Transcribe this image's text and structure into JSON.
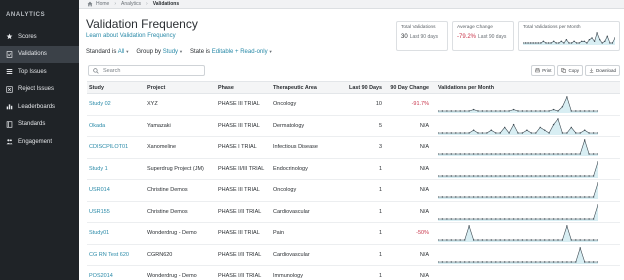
{
  "sidebar": {
    "title": "ANALYTICS",
    "items": [
      {
        "label": "Scores",
        "icon": "star-icon"
      },
      {
        "label": "Validations",
        "icon": "check-doc-icon",
        "active": true
      },
      {
        "label": "Top Issues",
        "icon": "list-icon"
      },
      {
        "label": "Reject Issues",
        "icon": "reject-icon"
      },
      {
        "label": "Leaderboards",
        "icon": "chart-icon"
      },
      {
        "label": "Standards",
        "icon": "book-icon"
      },
      {
        "label": "Engagement",
        "icon": "people-icon"
      }
    ]
  },
  "breadcrumb": [
    "Home",
    "Analytics",
    "Validations"
  ],
  "header": {
    "title": "Validation Frequency",
    "learn_link": "Learn about Validation Frequency"
  },
  "filters": {
    "standard_label": "Standard is",
    "standard_value": "All",
    "group_label": "Group by",
    "group_value": "Study",
    "state_label": "State is",
    "state_value": "Editable + Read-only"
  },
  "stats": {
    "total_label": "Total Validations",
    "total_value": "30",
    "total_sub": "Last 90 days",
    "avg_label": "Average Change",
    "avg_value": "-79.2%",
    "avg_sub": "Last 90 days",
    "month_label": "Total Validations per Month"
  },
  "search": {
    "placeholder": "Search"
  },
  "toolbar": {
    "print": "Print",
    "copy": "Copy",
    "download": "Download"
  },
  "table": {
    "headers": [
      "Study",
      "Project",
      "Phase",
      "Therapeutic Area",
      "Last 90 Days",
      "90 Day Change",
      "Validations per Month"
    ],
    "rows": [
      {
        "study": "Study 02",
        "project": "XYZ",
        "phase": "PHASE III TRIAL",
        "area": "Oncology",
        "last90": "10",
        "change": "-91.7%",
        "neg": true,
        "spark": [
          0,
          0,
          0,
          0,
          0,
          0,
          0,
          0,
          1,
          0,
          0,
          0,
          0,
          0,
          0,
          0,
          0,
          1,
          0,
          0,
          0,
          0,
          0,
          0,
          0,
          0,
          1,
          0,
          3,
          10,
          0,
          0,
          0,
          0,
          0,
          0,
          0
        ]
      },
      {
        "study": "Okada",
        "project": "Yamazaki",
        "phase": "PHASE III TRIAL",
        "area": "Dermatology",
        "last90": "5",
        "change": "N/A",
        "neg": false,
        "spark": [
          0,
          0,
          0,
          0,
          0,
          0,
          0,
          0,
          1,
          0,
          0,
          0,
          1,
          0,
          0,
          2,
          0,
          3,
          0,
          0,
          1,
          0,
          0,
          2,
          1,
          0,
          3,
          5,
          0,
          0,
          2,
          0,
          0,
          1,
          0,
          0,
          0
        ]
      },
      {
        "study": "CDISCPILOT01",
        "project": "Xanomeline",
        "phase": "PHASE I TRIAL",
        "area": "Infectious Disease",
        "last90": "3",
        "change": "N/A",
        "neg": false,
        "spark": [
          0,
          0,
          0,
          0,
          0,
          0,
          0,
          0,
          0,
          0,
          0,
          0,
          0,
          0,
          0,
          0,
          0,
          0,
          0,
          0,
          0,
          0,
          0,
          0,
          0,
          0,
          0,
          0,
          0,
          0,
          0,
          0,
          0,
          4,
          0,
          0,
          0
        ]
      },
      {
        "study": "Study 1",
        "project": "Superdrug Project (JM)",
        "phase": "PHASE II/III TRIAL",
        "area": "Endocrinology",
        "last90": "1",
        "change": "N/A",
        "neg": false,
        "spark": [
          0,
          0,
          0,
          0,
          0,
          0,
          0,
          0,
          0,
          0,
          0,
          0,
          0,
          0,
          0,
          0,
          0,
          0,
          0,
          0,
          0,
          0,
          0,
          0,
          0,
          0,
          0,
          0,
          0,
          0,
          0,
          0,
          0,
          0,
          0,
          0,
          3
        ]
      },
      {
        "study": "USR014",
        "project": "Christine Demos",
        "phase": "PHASE III TRIAL",
        "area": "Oncology",
        "last90": "1",
        "change": "N/A",
        "neg": false,
        "spark": [
          0,
          0,
          0,
          0,
          0,
          0,
          0,
          0,
          0,
          0,
          0,
          0,
          0,
          0,
          0,
          0,
          0,
          0,
          0,
          0,
          0,
          0,
          0,
          0,
          0,
          0,
          0,
          0,
          0,
          0,
          0,
          0,
          0,
          0,
          0,
          0,
          2
        ]
      },
      {
        "study": "USR155",
        "project": "Christine Demos",
        "phase": "PHASE I/II TRIAL",
        "area": "Cardiovascular",
        "last90": "1",
        "change": "N/A",
        "neg": false,
        "spark": [
          0,
          0,
          0,
          0,
          0,
          0,
          0,
          0,
          0,
          0,
          0,
          0,
          0,
          0,
          0,
          0,
          0,
          0,
          0,
          0,
          0,
          0,
          0,
          0,
          0,
          0,
          0,
          0,
          0,
          0,
          0,
          0,
          0,
          0,
          0,
          0,
          2
        ]
      },
      {
        "study": "Study01",
        "project": "Wonderdrug - Demo",
        "phase": "PHASE III TRIAL",
        "area": "Pain",
        "last90": "1",
        "change": "-50%",
        "neg": true,
        "spark": [
          0,
          0,
          0,
          0,
          0,
          0,
          0,
          1,
          0,
          0,
          0,
          0,
          0,
          0,
          0,
          0,
          0,
          0,
          0,
          0,
          0,
          0,
          0,
          0,
          0,
          0,
          0,
          0,
          0,
          1,
          0,
          0,
          0,
          0,
          0,
          0,
          0
        ]
      },
      {
        "study": "CG RN Test 620",
        "project": "CGRN620",
        "phase": "PHASE I/II TRIAL",
        "area": "Cardiovascular",
        "last90": "1",
        "change": "N/A",
        "neg": false,
        "spark": [
          0,
          0,
          0,
          0,
          0,
          0,
          0,
          0,
          0,
          0,
          0,
          0,
          0,
          0,
          0,
          0,
          0,
          0,
          0,
          0,
          0,
          0,
          0,
          0,
          0,
          0,
          0,
          0,
          0,
          0,
          0,
          0,
          1,
          0,
          0,
          0,
          0
        ]
      },
      {
        "study": "POS2014",
        "project": "Wonderdrug - Demo",
        "phase": "PHASE I/II TRIAL",
        "area": "Immunology",
        "last90": "1",
        "change": "N/A",
        "neg": false,
        "spark": [
          0,
          0,
          0,
          0,
          0,
          0,
          0,
          0,
          0,
          0,
          0,
          0,
          0,
          0,
          0,
          0,
          0,
          0,
          0,
          0,
          0,
          0,
          0,
          0,
          0,
          0,
          0,
          0,
          0,
          0,
          0,
          0,
          0,
          0,
          0,
          0,
          0
        ]
      }
    ]
  },
  "monthly_spark": [
    0,
    0,
    0,
    0,
    0,
    0,
    0,
    0,
    1,
    0,
    0,
    0,
    1,
    0,
    0,
    1,
    0,
    2,
    0,
    0,
    1,
    0,
    0,
    1,
    1,
    0,
    2,
    3,
    1,
    6,
    2,
    0,
    1,
    4,
    0,
    0,
    3
  ],
  "colors": {
    "accent": "#2a8aa8",
    "negative": "#c8344a",
    "sidebar": "#1f2327"
  }
}
